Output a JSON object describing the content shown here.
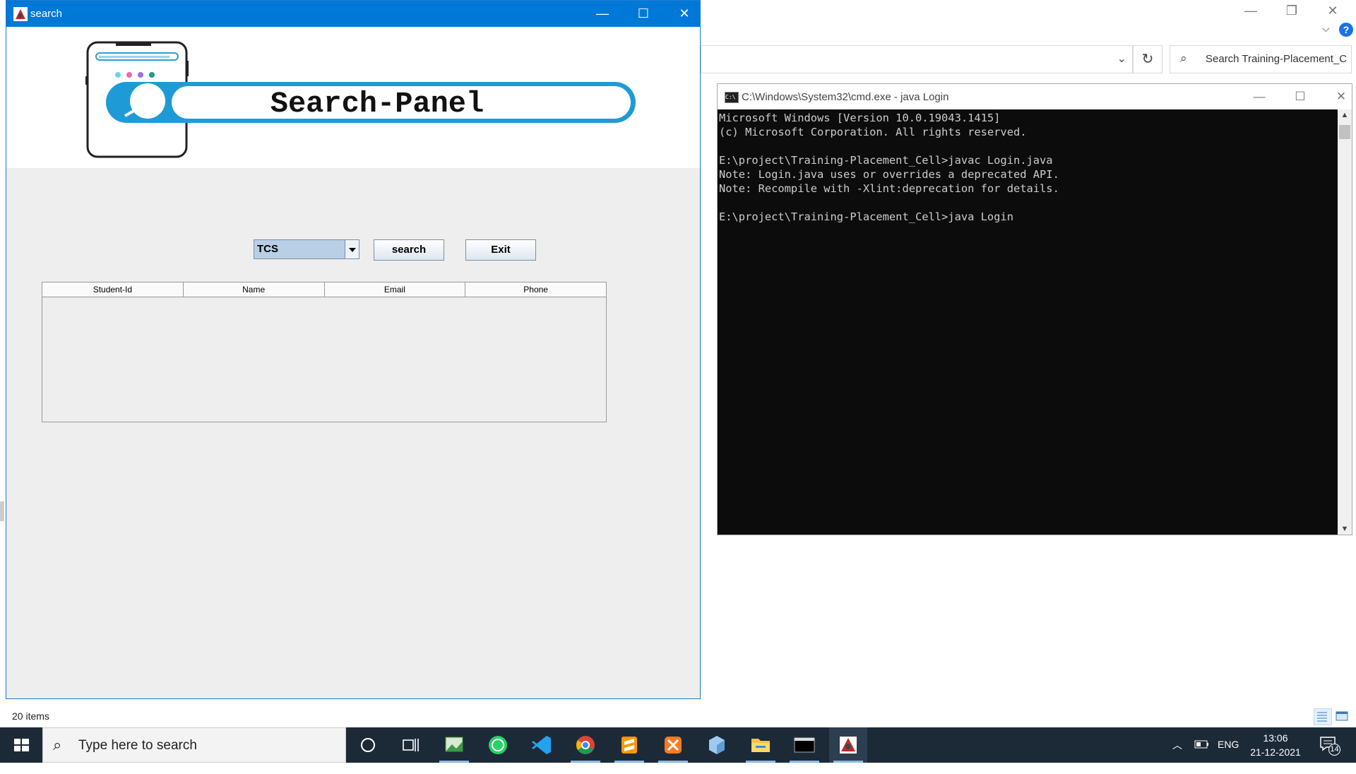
{
  "java_window": {
    "title": "search",
    "banner_text": "Search-Panel",
    "combo_value": "TCS",
    "search_button": "search",
    "exit_button": "Exit",
    "table_columns": [
      "Student-Id",
      "Name",
      "Email",
      "Phone"
    ],
    "table_rows": []
  },
  "explorer": {
    "search_placeholder": "Search Training-Placement_C...",
    "status_items": "20 items"
  },
  "cmd": {
    "title": "C:\\Windows\\System32\\cmd.exe - java  Login",
    "lines": [
      "Microsoft Windows [Version 10.0.19043.1415]",
      "(c) Microsoft Corporation. All rights reserved.",
      "",
      "E:\\project\\Training-Placement_Cell>javac Login.java",
      "Note: Login.java uses or overrides a deprecated API.",
      "Note: Recompile with -Xlint:deprecation for details.",
      "",
      "E:\\project\\Training-Placement_Cell>java Login"
    ]
  },
  "taskbar": {
    "search_placeholder": "Type here to search",
    "language": "ENG",
    "time": "13:06",
    "date": "21-12-2021",
    "notification_count": "14",
    "apps": [
      "image-editor-icon",
      "whatsapp-icon",
      "vscode-icon",
      "chrome-icon",
      "sublime-text-icon",
      "xampp-icon",
      "3d-viewer-icon",
      "file-explorer-icon",
      "terminal-icon",
      "java-app-icon"
    ]
  },
  "colors": {
    "title_bar": "#0078d7",
    "banner_accent": "#1e9bd7",
    "taskbar": "#1c2a38",
    "console_bg": "#0c0c0c",
    "combo_fill": "#b8cfe5"
  }
}
